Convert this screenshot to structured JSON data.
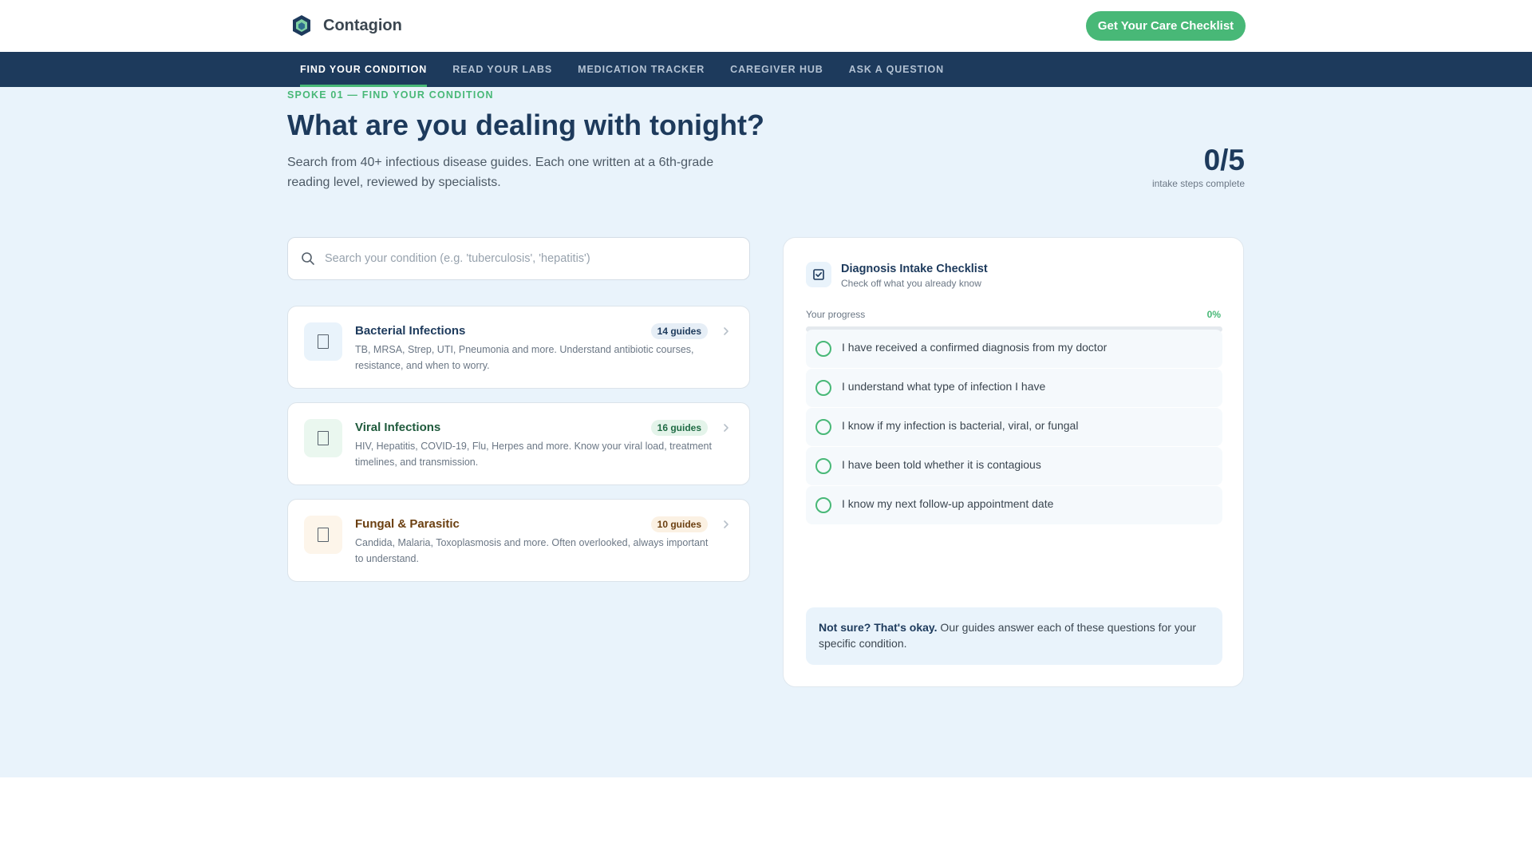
{
  "header": {
    "brand_name": "Contagion",
    "cta_label": "Get Your Care Checklist"
  },
  "nav": {
    "items": [
      {
        "label": "FIND YOUR CONDITION",
        "active": true
      },
      {
        "label": "READ YOUR LABS",
        "active": false
      },
      {
        "label": "MEDICATION TRACKER",
        "active": false
      },
      {
        "label": "CAREGIVER HUB",
        "active": false
      },
      {
        "label": "ASK A QUESTION",
        "active": false
      }
    ]
  },
  "hero": {
    "eyebrow": "SPOKE 01 — FIND YOUR CONDITION",
    "title": "What are you dealing with tonight?",
    "subtitle": "Search from 40+ infectious disease guides. Each one written at a 6th-grade reading level, reviewed by specialists.",
    "stat_value": "0/5",
    "stat_label": "intake steps complete"
  },
  "search": {
    "placeholder": "Search your condition (e.g. 'tuberculosis', 'hepatitis')",
    "value": ""
  },
  "categories": [
    {
      "title": "Bacterial Infections",
      "badge": "14 guides",
      "description": "TB, MRSA, Strep, UTI, Pneumonia and more. Understand antibiotic courses, resistance, and when to worry.",
      "title_color": "#1d3a5c",
      "badge_bg": "#e6eef6",
      "badge_color": "#1d3a5c",
      "icon_bg": "#e9f3fb"
    },
    {
      "title": "Viral Infections",
      "badge": "16 guides",
      "description": "HIV, Hepatitis, COVID-19, Flu, Herpes and more. Know your viral load, treatment timelines, and transmission.",
      "title_color": "#1f5a3c",
      "badge_bg": "#e4f4ea",
      "badge_color": "#1f6b44",
      "icon_bg": "#eaf7ef"
    },
    {
      "title": "Fungal & Parasitic",
      "badge": "10 guides",
      "description": "Candida, Malaria, Toxoplasmosis and more. Often overlooked, always important to understand.",
      "title_color": "#6b3f10",
      "badge_bg": "#fbf1e3",
      "badge_color": "#6b3f10",
      "icon_bg": "#fdf5ea"
    }
  ],
  "checklist": {
    "title": "Diagnosis Intake Checklist",
    "subtitle": "Check off what you already know",
    "progress_label": "Your progress",
    "progress_pct_text": "0%",
    "progress_fraction": 0,
    "items": [
      "I have received a confirmed diagnosis from my doctor",
      "I understand what type of infection I have",
      "I know if my infection is bacterial, viral, or fungal",
      "I have been told whether it is contagious",
      "I know my next follow-up appointment date"
    ],
    "note_bold": "Not sure? That's okay.",
    "note_text": " Our guides answer each of these questions for your specific condition."
  },
  "colors": {
    "accent": "#48b877",
    "navy": "#1d3a5c",
    "page_bg": "#e9f3fb"
  }
}
